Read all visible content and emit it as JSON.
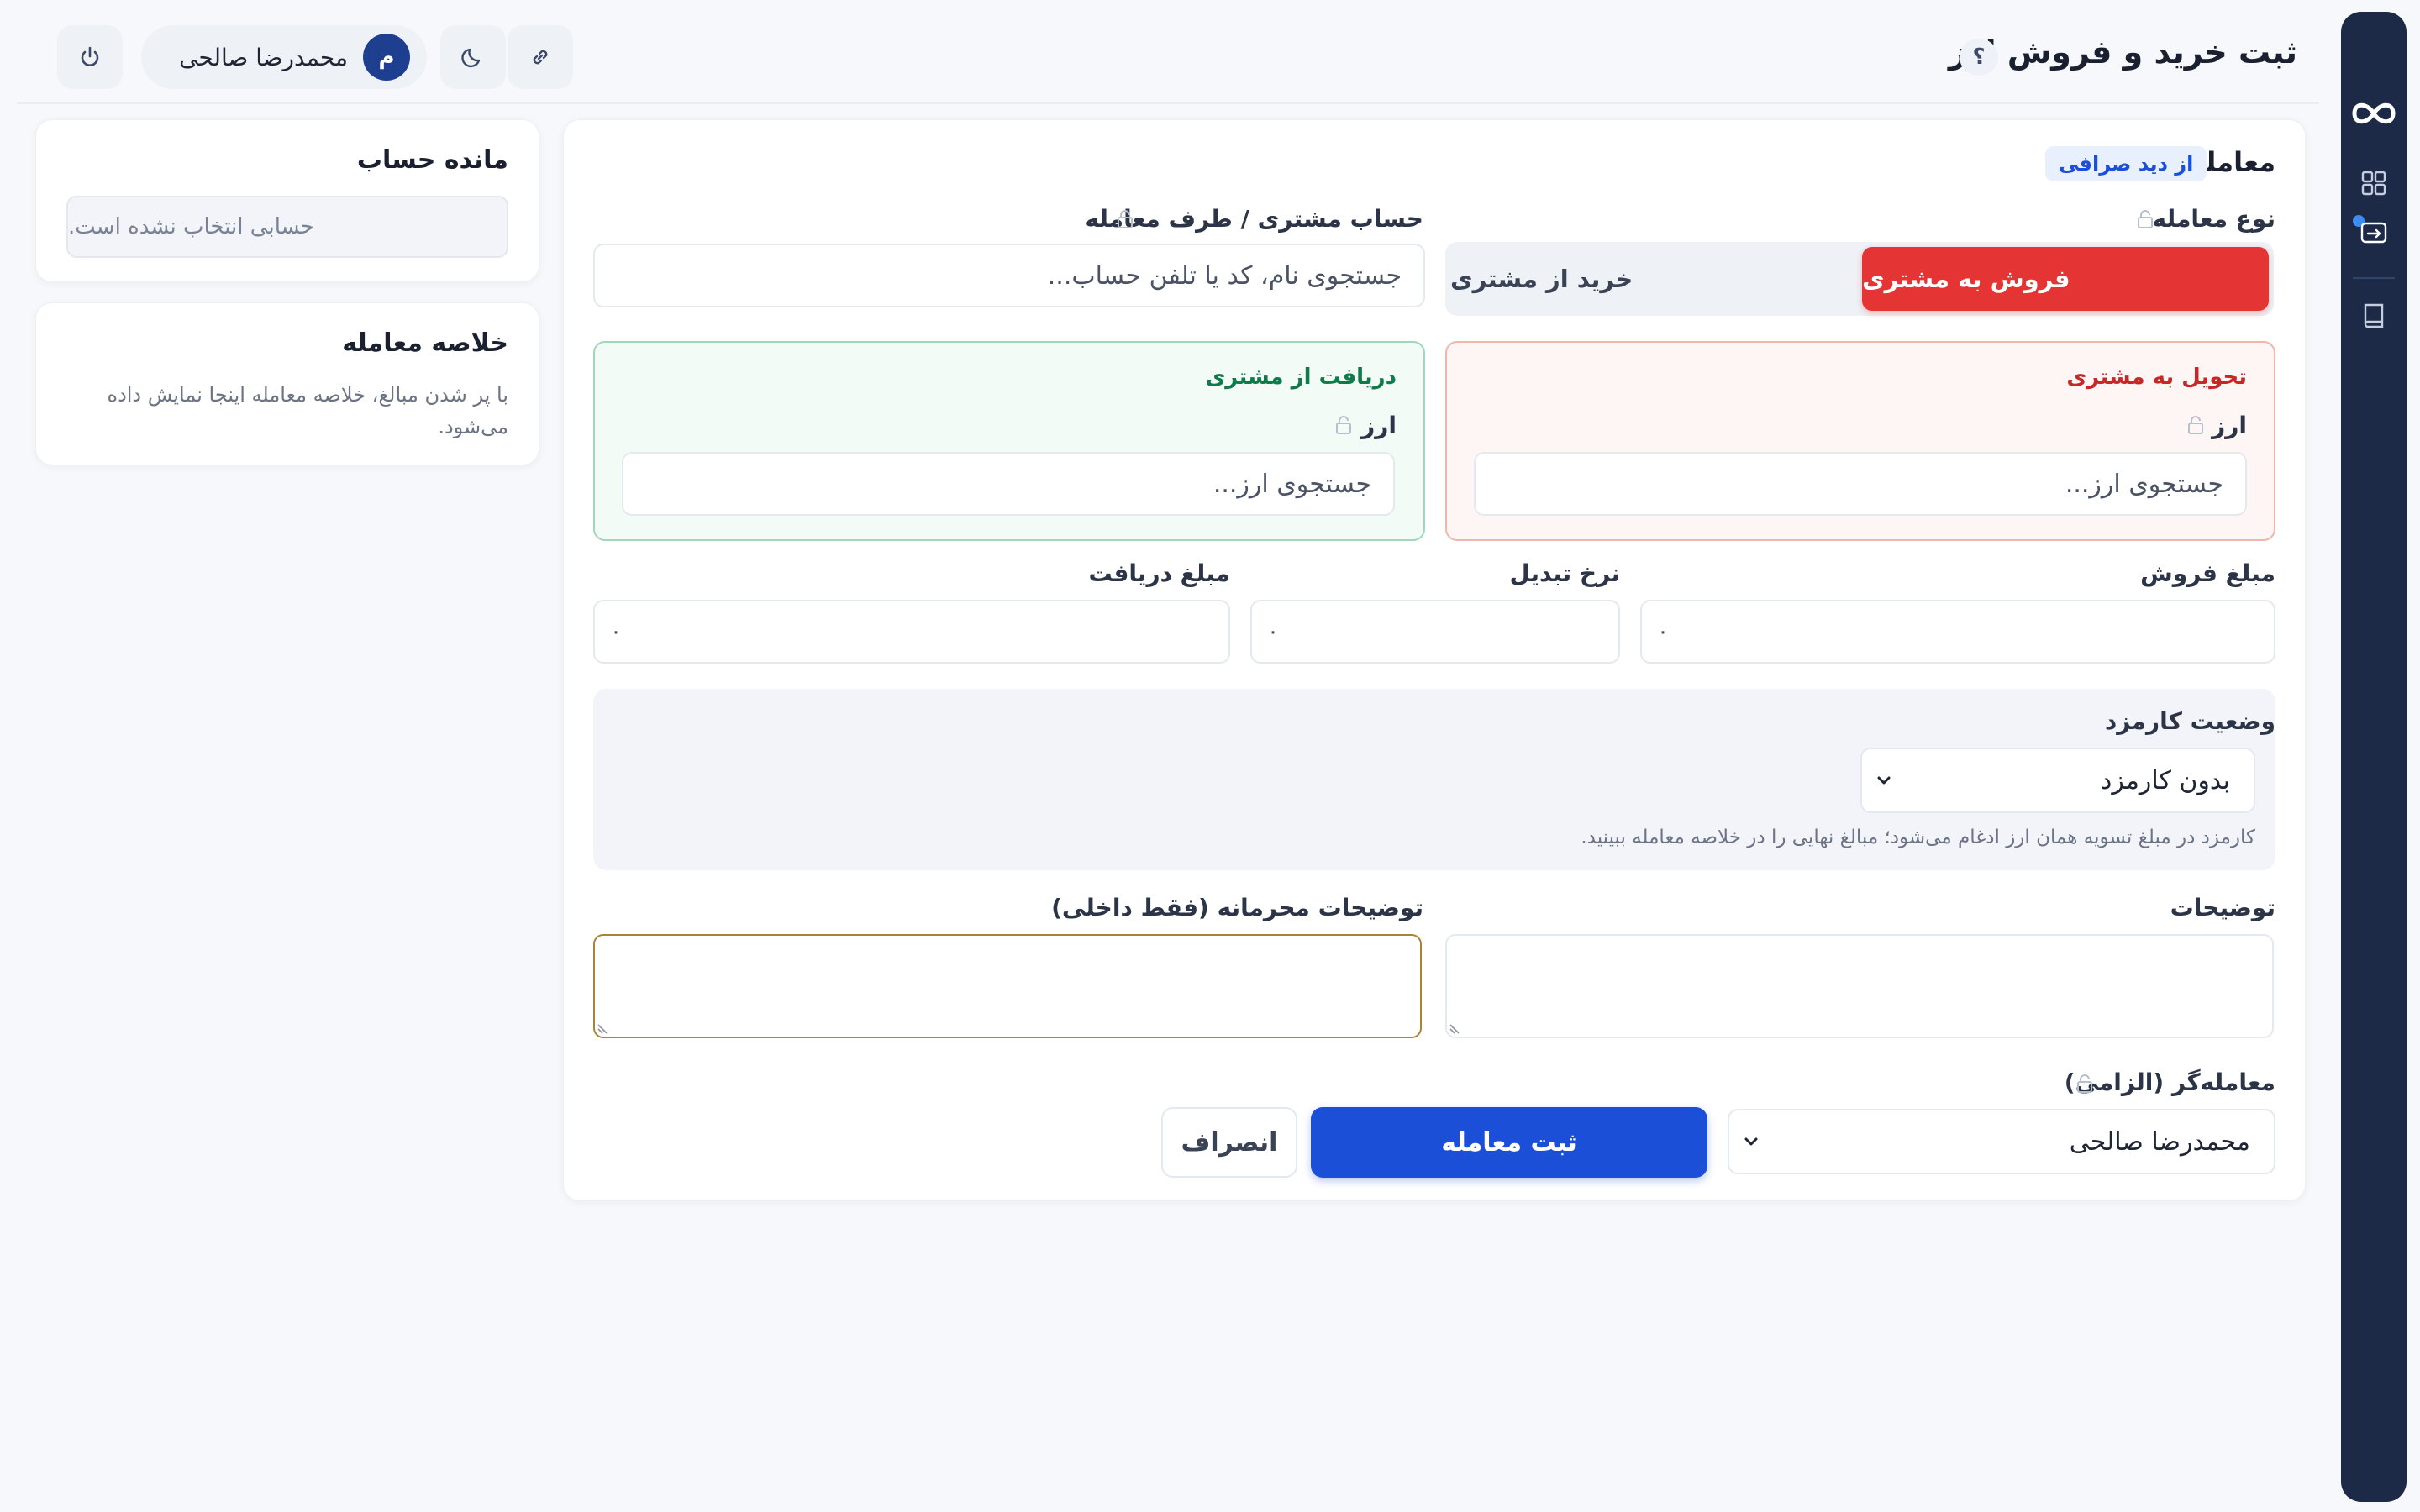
{
  "header": {
    "title": "ثبت خرید و فروش ارز",
    "help": "؟",
    "user_name": "محمدرضا صالحی",
    "user_initial": "م",
    "icons": [
      "power-icon",
      "moon-icon",
      "link-icon"
    ]
  },
  "rail": {
    "icons": [
      "infinity-logo",
      "dashboard-icon",
      "exchange-icon",
      "book-icon"
    ]
  },
  "balance_card": {
    "title": "مانده حساب",
    "empty_text": "حسابی انتخاب نشده است."
  },
  "summary_card": {
    "title": "خلاصه معامله",
    "hint": "با پر شدن مبالغ، خلاصه معامله اینجا نمایش داده می‌شود."
  },
  "form": {
    "title": "معامله",
    "badge": "از دید صرافی",
    "type_label": "نوع معامله",
    "type_options": [
      "فروش به مشتری",
      "خرید از مشتری"
    ],
    "type_selected": "فروش به مشتری",
    "account_label": "حساب مشتری / طرف معامله",
    "account_placeholder": "جستجوی نام، کد یا تلفن حساب...",
    "deliver_panel": {
      "title": "تحویل به مشتری",
      "currency_label": "ارز",
      "currency_placeholder": "جستجوی ارز..."
    },
    "receive_panel": {
      "title": "دریافت از مشتری",
      "currency_label": "ارز",
      "currency_placeholder": "جستجوی ارز..."
    },
    "sale_amount_label": "مبلغ فروش",
    "sale_amount_value": "۰",
    "rate_label": "نرخ تبدیل",
    "rate_value": "۰",
    "receive_amount_label": "مبلغ دریافت",
    "receive_amount_value": "۰",
    "fee_label": "وضعیت کارمزد",
    "fee_value": "بدون کارمزد",
    "fee_hint": "کارمزد در مبلغ تسویه همان ارز ادغام می‌شود؛ مبالغ نهایی را در خلاصه معامله ببینید.",
    "notes_label": "توضیحات",
    "private_notes_label": "توضیحات محرمانه (فقط داخلی)",
    "dealer_label": "معامله‌گر (الزامی)",
    "dealer_value": "محمدرضا صالحی",
    "submit_label": "ثبت معامله",
    "cancel_label": "انصراف"
  },
  "colors": {
    "accent_blue": "#1c4fd8",
    "sell_red": "#e53434",
    "deliver_title": "#c62828",
    "receive_title": "#0f7a4a",
    "rail": "#1c2a48"
  }
}
